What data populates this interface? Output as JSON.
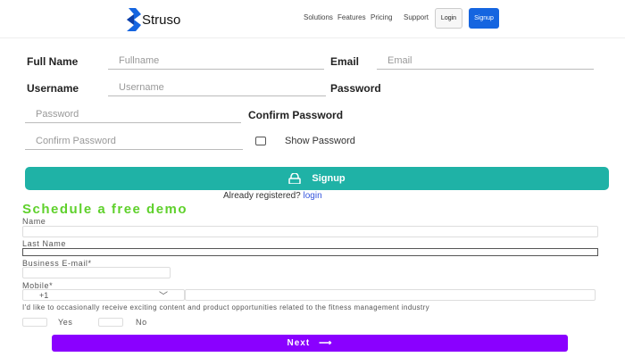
{
  "nav": {
    "brand": "Struso",
    "links": [
      "Solutions",
      "Features",
      "Pricing",
      "Support"
    ],
    "login": "Login",
    "signup": "Signup"
  },
  "signup_form": {
    "full_name_label": "Full Name",
    "full_name_placeholder": "Fullname",
    "email_label": "Email",
    "email_placeholder": "Email",
    "username_label": "Username",
    "username_placeholder": "Username",
    "password_label": "Password",
    "password_placeholder": "Password",
    "confirm_label": "Confirm Password",
    "confirm_placeholder": "Confirm Password",
    "show_password": "Show Password",
    "submit": "Signup",
    "already": "Already registered?",
    "login_link": "login"
  },
  "demo": {
    "title": "Schedule a free demo",
    "name": "Name",
    "last_name": "Last Name",
    "email": "Business E-mail*",
    "mobile": "Mobile*",
    "country_code": "+1",
    "consent": "I'd like to occasionally receive exciting content and product opportunities related to the fitness management industry",
    "yes": "Yes",
    "no": "No",
    "next": "Next",
    "next_arrow": "⟶"
  },
  "colors": {
    "brand": "#1565e0",
    "teal": "#1fb2a6",
    "green": "#5fd12c",
    "purple": "#8a00ff"
  }
}
